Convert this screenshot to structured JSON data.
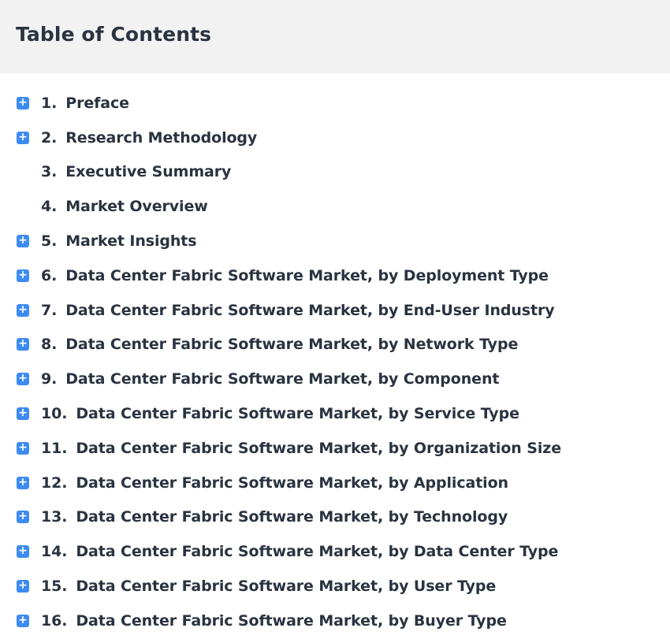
{
  "header": {
    "title": "Table of Contents"
  },
  "colors": {
    "accent": "#3d8bf0",
    "text": "#2b3340",
    "header_bg": "#f2f2f2"
  },
  "icons": {
    "expand": "plus-square-icon"
  },
  "expand_symbol": "+",
  "toc": [
    {
      "num": "1.",
      "label": "Preface",
      "expandable": true
    },
    {
      "num": "2.",
      "label": "Research Methodology",
      "expandable": true
    },
    {
      "num": "3.",
      "label": "Executive Summary",
      "expandable": false
    },
    {
      "num": "4.",
      "label": "Market Overview",
      "expandable": false
    },
    {
      "num": "5.",
      "label": "Market Insights",
      "expandable": true
    },
    {
      "num": "6.",
      "label": "Data Center Fabric Software Market, by Deployment Type",
      "expandable": true
    },
    {
      "num": "7.",
      "label": "Data Center Fabric Software Market, by End-User Industry",
      "expandable": true
    },
    {
      "num": "8.",
      "label": "Data Center Fabric Software Market, by Network Type",
      "expandable": true
    },
    {
      "num": "9.",
      "label": "Data Center Fabric Software Market, by Component",
      "expandable": true
    },
    {
      "num": "10.",
      "label": "Data Center Fabric Software Market, by Service Type",
      "expandable": true
    },
    {
      "num": "11.",
      "label": "Data Center Fabric Software Market, by Organization Size",
      "expandable": true
    },
    {
      "num": "12.",
      "label": "Data Center Fabric Software Market, by Application",
      "expandable": true
    },
    {
      "num": "13.",
      "label": "Data Center Fabric Software Market, by Technology",
      "expandable": true
    },
    {
      "num": "14.",
      "label": "Data Center Fabric Software Market, by Data Center Type",
      "expandable": true
    },
    {
      "num": "15.",
      "label": "Data Center Fabric Software Market, by User Type",
      "expandable": true
    },
    {
      "num": "16.",
      "label": "Data Center Fabric Software Market, by Buyer Type",
      "expandable": true
    }
  ]
}
